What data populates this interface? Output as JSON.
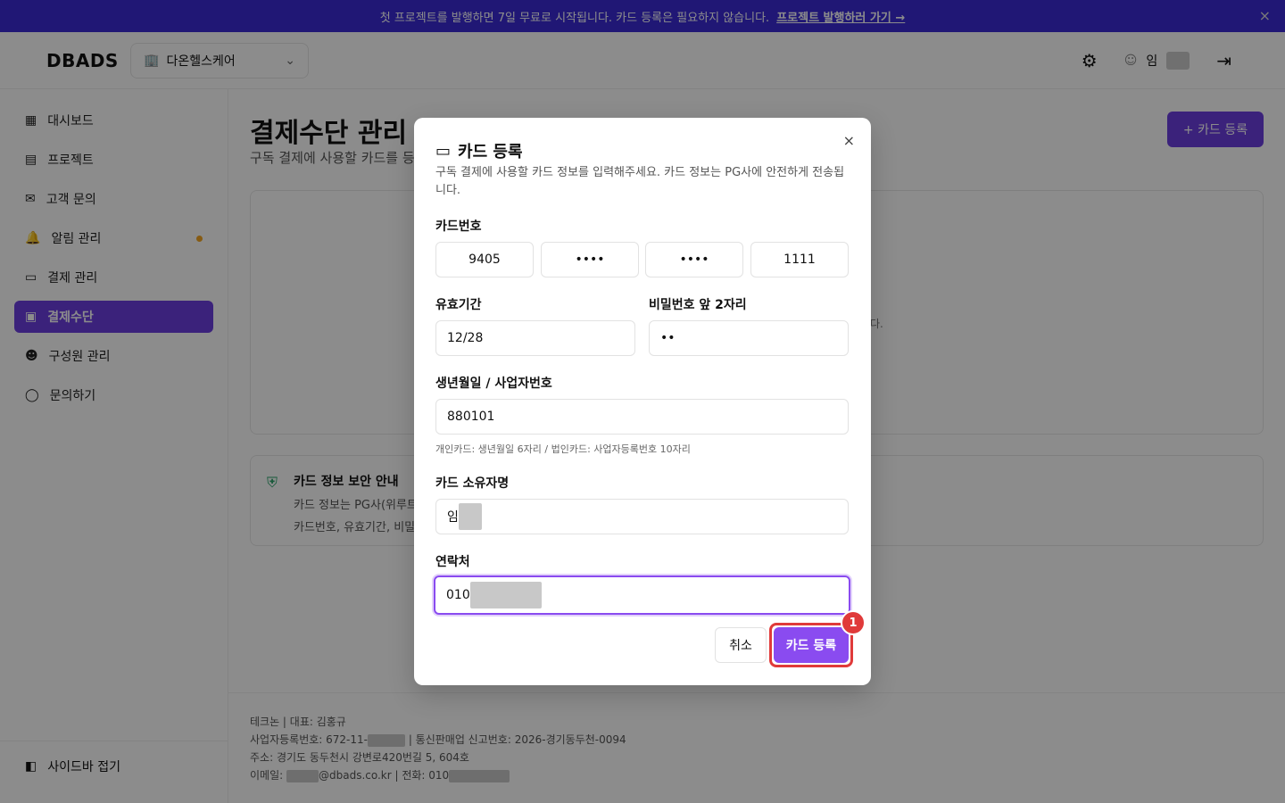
{
  "banner": {
    "text": "첫 프로젝트를 발행하면 7일 무료로 시작됩니다. 카드 등록은 필요하지 않습니다.",
    "link": "프로젝트 발행하러 가기 →",
    "close": "×"
  },
  "header": {
    "logo": "DBADS",
    "org": "다온헬스케어",
    "user_prefix": "임"
  },
  "sidebar": {
    "items": [
      {
        "label": "대시보드",
        "icon": "dashboard-icon"
      },
      {
        "label": "프로젝트",
        "icon": "folder-icon"
      },
      {
        "label": "고객 문의",
        "icon": "inbox-icon"
      },
      {
        "label": "알림 관리",
        "icon": "bell-icon"
      },
      {
        "label": "결제 관리",
        "icon": "card-icon"
      },
      {
        "label": "결제수단",
        "icon": "wallet-icon"
      },
      {
        "label": "구성원 관리",
        "icon": "users-icon"
      },
      {
        "label": "문의하기",
        "icon": "chat-icon"
      }
    ],
    "collapse": "사이드바 접기"
  },
  "main": {
    "title": "결제수단 관리",
    "subtitle": "구독 결제에 사용할 카드를 등",
    "add_button": "+ 카드 등록",
    "panel_tail": "다.",
    "security": {
      "title": "카드 정보 보안 안내",
      "line1": "카드 정보는 PG사(위루트",
      "line2": "카드번호, 유효기간, 비밀"
    }
  },
  "footer": {
    "line1": "테크논 | 대표: 김홍규",
    "line2a": "사업자등록번호: 672-11-",
    "line2b": "| 통신판매업 신고번호: 2026-경기동두천-0094",
    "line3": "주소: 경기도 동두천시 강변로420번길 5, 604호",
    "line4a": "이메일: ",
    "line4b": "@dbads.co.kr | 전화: 010"
  },
  "modal": {
    "title": "카드 등록",
    "desc": "구독 결제에 사용할 카드 정보를 입력해주세요. 카드 정보는 PG사에 안전하게 전송됩니다.",
    "card_label": "카드번호",
    "card": [
      "9405",
      "••••",
      "••••",
      "1111"
    ],
    "expiry_label": "유효기간",
    "expiry": "12/28",
    "pw_label": "비밀번호 앞 2자리",
    "pw": "••",
    "birth_label": "생년월일 / 사업자번호",
    "birth": "880101",
    "birth_hint": "개인카드: 생년월일 6자리 / 법인카드: 사업자등록번호 10자리",
    "owner_label": "카드 소유자명",
    "owner": "임",
    "phone_label": "연락처",
    "phone": "010",
    "cancel": "취소",
    "submit": "카드 등록",
    "close": "×"
  },
  "annotation": {
    "badge": "1"
  },
  "colors": {
    "brand": "#6c3ee0",
    "submit": "#8a4bf0",
    "highlight": "#e03a3a",
    "banner": "#3b2bd6"
  }
}
